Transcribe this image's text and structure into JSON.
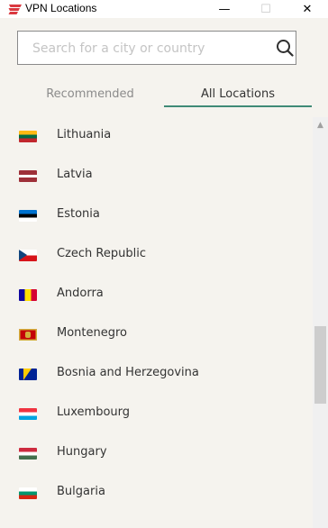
{
  "window": {
    "title": "VPN Locations",
    "minimize": "—",
    "maximize": "☐",
    "close": "✕"
  },
  "search": {
    "placeholder": "Search for a city or country",
    "value": "",
    "icon": "search-icon"
  },
  "tabs": [
    {
      "label": "Recommended",
      "active": false
    },
    {
      "label": "All Locations",
      "active": true
    }
  ],
  "accent_color": "#3f8a77",
  "locations": [
    {
      "name": "Lithuania",
      "flag": [
        "#fdb913",
        "#006a44",
        "#c1272d"
      ]
    },
    {
      "name": "Latvia",
      "flag": [
        "#9e3039",
        "#ffffff",
        "#9e3039"
      ]
    },
    {
      "name": "Estonia",
      "flag": [
        "#0072ce",
        "#000000",
        "#ffffff"
      ]
    },
    {
      "name": "Czech Republic",
      "flag": [
        "#ffffff",
        "#d7141a",
        "#11457e"
      ]
    },
    {
      "name": "Andorra",
      "flag": [
        "#10069f",
        "#fedf00",
        "#d50032"
      ]
    },
    {
      "name": "Montenegro",
      "flag": [
        "#c40308",
        "#d3ae3b"
      ]
    },
    {
      "name": "Bosnia and Herzegovina",
      "flag": [
        "#002395",
        "#fecb00",
        "#ffffff"
      ]
    },
    {
      "name": "Luxembourg",
      "flag": [
        "#ef3340",
        "#ffffff",
        "#00a3e0"
      ]
    },
    {
      "name": "Hungary",
      "flag": [
        "#cd2a3e",
        "#ffffff",
        "#436f4d"
      ]
    },
    {
      "name": "Bulgaria",
      "flag": [
        "#ffffff",
        "#00966e",
        "#d62612"
      ]
    }
  ]
}
